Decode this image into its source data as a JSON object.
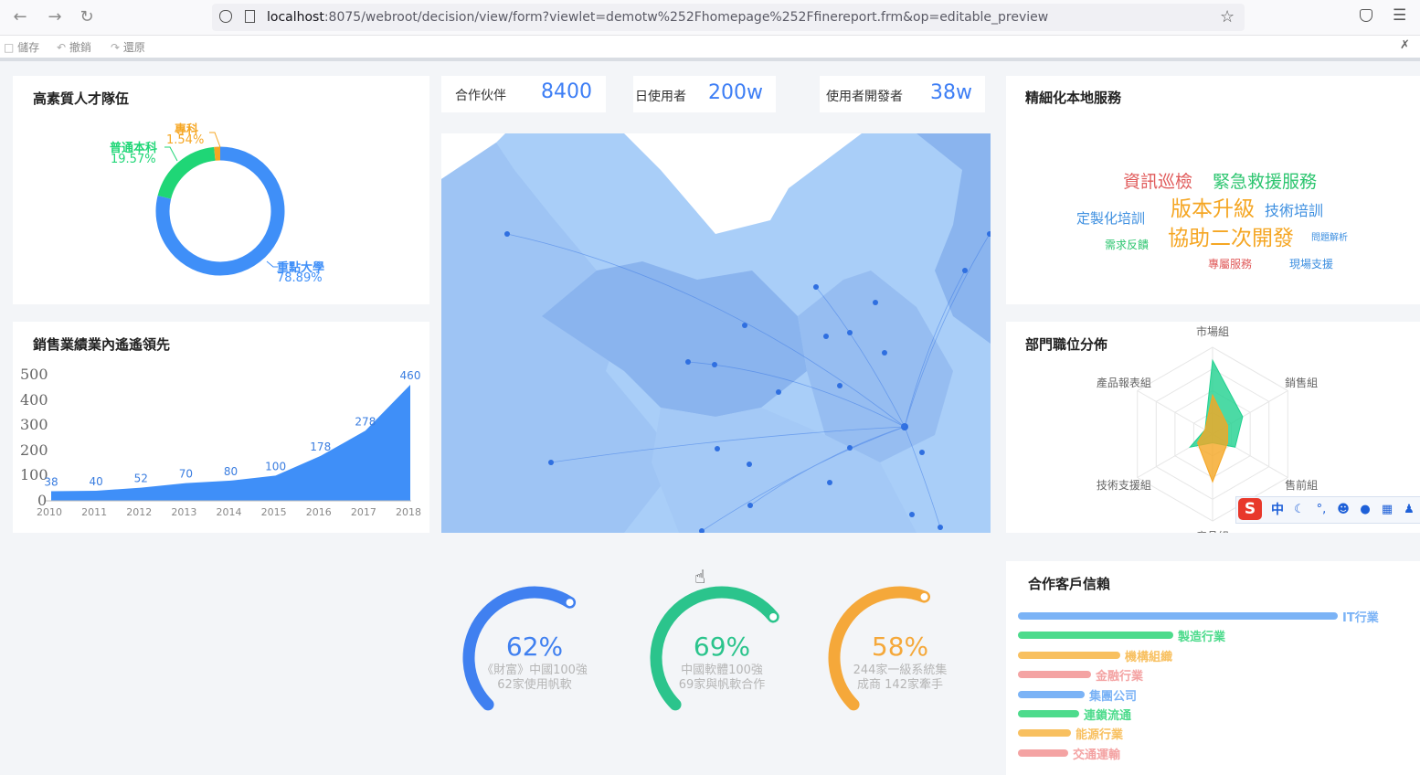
{
  "browser": {
    "url_host": "localhost",
    "url_rest": ":8075/webroot/decision/view/form?viewlet=demotw%252Fhomepage%252Ffinereport.frm&op=editable_preview"
  },
  "toolbar": {
    "save": "儲存",
    "undo": "撤銷",
    "redo": "還原"
  },
  "talent": {
    "title": "高素質人才隊伍",
    "chart_data": {
      "type": "pie",
      "title": "高素質人才隊伍",
      "slices": [
        {
          "label": "重點大學",
          "pct": "78.89%",
          "value": 78.89,
          "color": "#3f8ff8"
        },
        {
          "label": "普通本科",
          "pct": "19.57%",
          "value": 19.57,
          "color": "#1fd676"
        },
        {
          "label": "專科",
          "pct": "1.54%",
          "value": 1.54,
          "color": "#f5a623"
        }
      ]
    }
  },
  "sales": {
    "title": "銷售業績業內遙遙領先",
    "chart_data": {
      "type": "area",
      "title": "銷售業績業內遙遙領先",
      "categories": [
        "2010",
        "2011",
        "2012",
        "2013",
        "2014",
        "2015",
        "2016",
        "2017",
        "2018"
      ],
      "values": [
        38,
        40,
        52,
        70,
        80,
        100,
        178,
        278,
        460
      ],
      "ylim": [
        0,
        500
      ],
      "yticks": [
        "0",
        "100",
        "200",
        "300",
        "400",
        "500"
      ],
      "color": "#3f8ff8"
    }
  },
  "stats": [
    {
      "label": "合作伙伴",
      "value": "8400"
    },
    {
      "label": "日使用者",
      "value": "200w"
    },
    {
      "label": "使用者開發者",
      "value": "38w"
    }
  ],
  "local_service": {
    "title": "精細化本地服務",
    "words": [
      {
        "text": "資訊巡檢",
        "color": "#e05a5a"
      },
      {
        "text": "緊急救援服務",
        "color": "#2cc56f"
      },
      {
        "text": "版本升級",
        "color": "#f5a623"
      },
      {
        "text": "技術培訓",
        "color": "#3d8fe0"
      },
      {
        "text": "定製化培訓",
        "color": "#3d8fe0"
      },
      {
        "text": "協助二次開發",
        "color": "#f5a623"
      },
      {
        "text": "問題解析",
        "color": "#3d8fe0"
      },
      {
        "text": "需求反饋",
        "color": "#2cc56f"
      },
      {
        "text": "專屬服務",
        "color": "#e05a5a"
      },
      {
        "text": "現場支援",
        "color": "#3d8fe0"
      }
    ]
  },
  "department": {
    "title": "部門職位分佈",
    "chart_data": {
      "type": "radar",
      "axes": [
        "市場組",
        "銷售組",
        "售前組",
        "產品組",
        "技術支援組",
        "產品報表組"
      ],
      "series": [
        {
          "color": "#1fd18f",
          "values": [
            0.85,
            0.4,
            0.3,
            0.1,
            0.3,
            0.1
          ]
        },
        {
          "color": "#f5a623",
          "values": [
            0.45,
            0.2,
            0.2,
            0.55,
            0.2,
            0.1
          ]
        }
      ]
    }
  },
  "ime": {
    "zh": "中"
  },
  "gauges": [
    {
      "pct": "62%",
      "value": 0.62,
      "color": "#4080f0",
      "line1": "《財富》中國100強",
      "line2": "62家使用帆軟"
    },
    {
      "pct": "69%",
      "value": 0.69,
      "color": "#2bc48c",
      "line1": "中國軟體100強",
      "line2": "69家與帆軟合作"
    },
    {
      "pct": "58%",
      "value": 0.58,
      "color": "#f5a83a",
      "line1": "244家一級系統集",
      "line2": "成商 142家牽手"
    }
  ],
  "clients": {
    "title": "合作客戶信賴",
    "chart_data": {
      "type": "bar",
      "categories": [
        "IT行業",
        "製造行業",
        "機構組織",
        "金融行業",
        "集團公司",
        "連鎖流通",
        "能源行業",
        "交通運輸"
      ],
      "values": [
        350,
        170,
        112,
        80,
        73,
        67,
        58,
        55
      ],
      "colors": [
        "#7bb3f6",
        "#4ddb8c",
        "#f8c060",
        "#f4a3a3",
        "#7bb3f6",
        "#4ddb8c",
        "#f8c060",
        "#f4a3a3"
      ]
    }
  }
}
